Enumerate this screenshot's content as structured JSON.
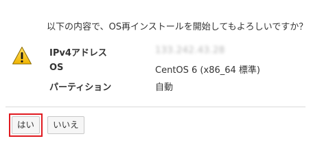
{
  "dialog": {
    "question": "以下の内容で、OS再インストールを開始してもよろしいですか？",
    "icon": "warning-icon",
    "details": [
      {
        "label": "IPv4アドレス",
        "value": "133.242.43.28"
      },
      {
        "label": "OS",
        "value": "CentOS 6 (x86_64 標準)"
      },
      {
        "label": "パーティション",
        "value": "自動"
      }
    ],
    "buttons": {
      "yes": "はい",
      "no": "いいえ"
    },
    "colors": {
      "highlight": "#e0191f",
      "warning": "#f5c400"
    }
  }
}
